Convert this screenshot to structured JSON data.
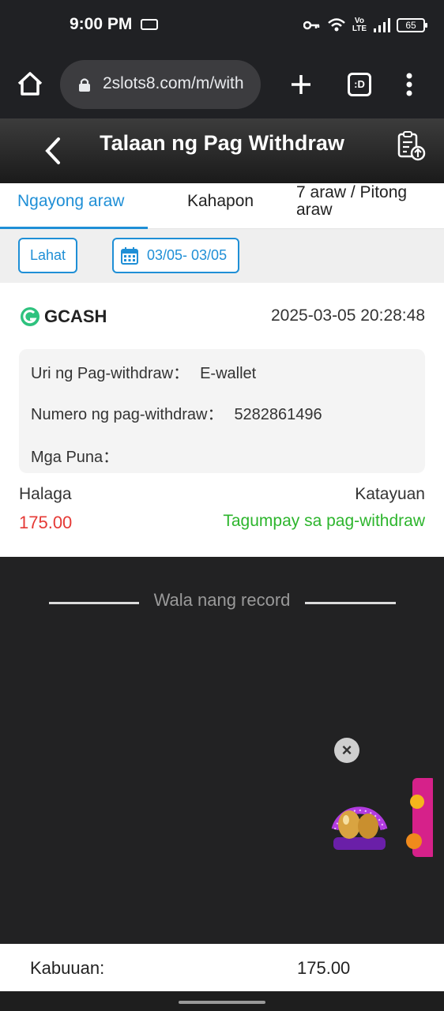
{
  "status_bar": {
    "time": "9:00 PM",
    "volte_top": "Vo",
    "volte_bottom": "LTE",
    "battery": "65",
    "icons": [
      "key-icon",
      "wifi-icon",
      "signal-icon",
      "battery-icon"
    ]
  },
  "browser": {
    "url": "2slots8.com/m/with",
    "tabs_label": ":D",
    "icons": [
      "home-icon",
      "lock-icon",
      "plus-icon",
      "tabs-icon",
      "menu-icon"
    ]
  },
  "header": {
    "title": "Talaan ng Pag Withdraw",
    "icons": [
      "back-icon",
      "record-upload-icon"
    ]
  },
  "tabs": [
    {
      "label": "Ngayong araw",
      "active": true
    },
    {
      "label": "Kahapon",
      "active": false
    },
    {
      "label": "7 araw / Pitong araw",
      "active": false
    }
  ],
  "filters": {
    "all_label": "Lahat",
    "date_range": "03/05- 03/05"
  },
  "record": {
    "method": "GCASH",
    "datetime": "2025-03-05 20:28:48",
    "type_label": "Uri ng Pag-withdraw：",
    "type_value": "E-wallet",
    "number_label": "Numero ng pag-withdraw：",
    "number_value": "5282861496",
    "remarks_label": "Mga Puna：",
    "remarks_value": "",
    "amount_label": "Halaga",
    "amount_value": "175.00",
    "status_label": "Katayuan",
    "status_value": "Tagumpay sa pag-withdraw"
  },
  "list_end": {
    "text": "Wala nang record"
  },
  "promo": {
    "close_label": "×"
  },
  "total": {
    "label": "Kabuuan:",
    "value": "175.00"
  },
  "colors": {
    "accent": "#1f8fd6",
    "amount": "#e53935",
    "success": "#2db52d",
    "gcash": "#2ec27e"
  }
}
